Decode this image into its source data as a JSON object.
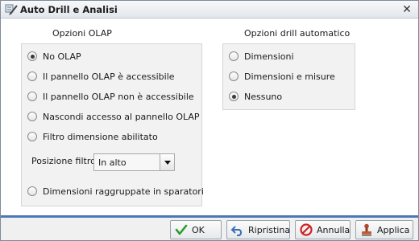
{
  "window": {
    "title": "Auto Drill e Analisi",
    "close_icon": "close-icon"
  },
  "olap": {
    "title": "Opzioni OLAP",
    "options": [
      {
        "label": "No OLAP",
        "checked": true
      },
      {
        "label": "Il pannello OLAP è accessibile",
        "checked": false
      },
      {
        "label": "Il pannello OLAP non è accessibile",
        "checked": false
      },
      {
        "label": "Nascondi accesso al pannello OLAP",
        "checked": false
      },
      {
        "label": "Filtro dimensione abilitato",
        "checked": false
      }
    ],
    "position_label": "Posizione filtro",
    "position_value": "In alto",
    "grouped_option": {
      "label": "Dimensioni raggruppate in sparatori",
      "checked": false
    }
  },
  "drill": {
    "title": "Opzioni drill automatico",
    "options": [
      {
        "label": "Dimensioni",
        "checked": false
      },
      {
        "label": "Dimensioni e misure",
        "checked": false
      },
      {
        "label": "Nessuno",
        "checked": true
      }
    ]
  },
  "buttons": {
    "ok": "OK",
    "reset": "Ripristina",
    "cancel": "Annulla",
    "apply": "Applica"
  },
  "colors": {
    "accent": "#4a78b5",
    "ok_check": "#2e9b2e",
    "cancel_red": "#d02020"
  }
}
